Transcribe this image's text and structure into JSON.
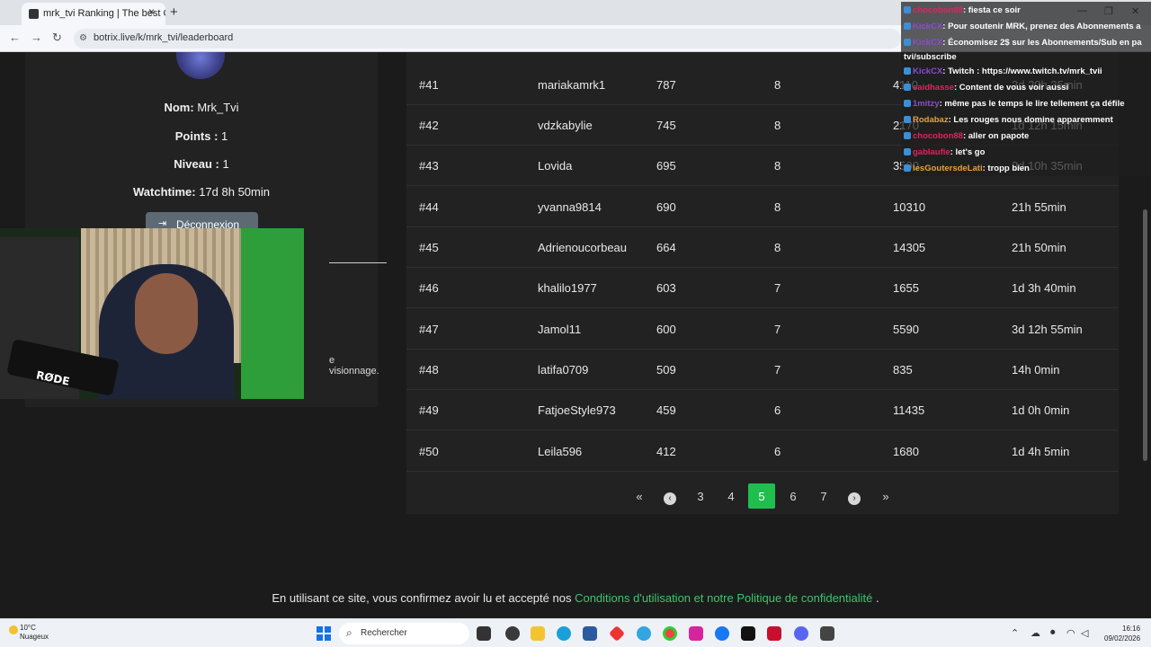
{
  "browser": {
    "tab_title": "mrk_tvi Ranking | The best Cha",
    "url": "botrix.live/k/mrk_tvi/leaderboard",
    "new_tab_label": "+",
    "tab_close_label": "×",
    "back_label": "←",
    "forward_label": "→",
    "reload_label": "↻",
    "minimize_label": "—",
    "restore_label": "❐",
    "window_close_label": "✕"
  },
  "profile": {
    "name_label": "Nom:",
    "name_value": "Mrk_Tvi",
    "points_label": "Points :",
    "points_value": "1",
    "level_label": "Niveau :",
    "level_value": "1",
    "watchtime_label": "Watchtime:",
    "watchtime_value": "17d 8h 50min",
    "logout_label": "Déconnexion",
    "partial_text": "e visionnage."
  },
  "webcam": {
    "mic_label": "RØDE"
  },
  "leaderboard": {
    "rows": [
      {
        "rank": "#41",
        "user": "mariakamrk1",
        "points": "787",
        "level": "8",
        "messages": "4110",
        "watchtime": "2d 20h 35min"
      },
      {
        "rank": "#42",
        "user": "vdzkabylie",
        "points": "745",
        "level": "8",
        "messages": "2170",
        "watchtime": "1d 12h 15min"
      },
      {
        "rank": "#43",
        "user": "Lovida",
        "points": "695",
        "level": "8",
        "messages": "3500",
        "watchtime": "2d 10h 35min"
      },
      {
        "rank": "#44",
        "user": "yvanna9814",
        "points": "690",
        "level": "8",
        "messages": "10310",
        "watchtime": "21h 55min"
      },
      {
        "rank": "#45",
        "user": "Adrienoucorbeau",
        "points": "664",
        "level": "8",
        "messages": "14305",
        "watchtime": "21h 50min"
      },
      {
        "rank": "#46",
        "user": "khalilo1977",
        "points": "603",
        "level": "7",
        "messages": "1655",
        "watchtime": "1d 3h 40min"
      },
      {
        "rank": "#47",
        "user": "Jamol11",
        "points": "600",
        "level": "7",
        "messages": "5590",
        "watchtime": "3d 12h 55min"
      },
      {
        "rank": "#48",
        "user": "latifa0709",
        "points": "509",
        "level": "7",
        "messages": "835",
        "watchtime": "14h 0min"
      },
      {
        "rank": "#49",
        "user": "FatjoeStyle973",
        "points": "459",
        "level": "6",
        "messages": "11435",
        "watchtime": "1d 0h 0min"
      },
      {
        "rank": "#50",
        "user": "Leila596",
        "points": "412",
        "level": "6",
        "messages": "1680",
        "watchtime": "1d 4h 5min"
      }
    ]
  },
  "pagination": {
    "first": "«",
    "prev": "‹",
    "pages": [
      "3",
      "4",
      "5",
      "6",
      "7"
    ],
    "active_page": "5",
    "next": "›",
    "last": "»"
  },
  "footer": {
    "text": "En utilisant ce site, vous confirmez avoir lu et accepté nos",
    "link": "Conditions d'utilisation et notre Politique de confidentialité",
    "end": "."
  },
  "chat": {
    "messages": [
      {
        "user": "chocobon88",
        "text": ": fiesta ce soir",
        "color": "#e0245e"
      },
      {
        "user": "KickCX",
        "text": ": Pour soutenir MRK, prenez des Abonnements a",
        "color": "#8a4bd6"
      },
      {
        "user": "KickCX",
        "text": ": Économisez 2$ sur les Abonnements/Sub en pa",
        "color": "#8a4bd6"
      },
      {
        "user": "",
        "text": "tvi/subscribe",
        "color": "#ffffff"
      },
      {
        "user": "KickCX",
        "text": ": Twitch : https://www.twitch.tv/mrk_tvii",
        "color": "#8a4bd6"
      },
      {
        "user": "saidhasse",
        "text": ": Content de vous voir aussi",
        "color": "#e0245e"
      },
      {
        "user": "1mitzy",
        "text": ": même pas le temps le lire tellement ça défile",
        "color": "#8a4bd6"
      },
      {
        "user": "Rodabaz",
        "text": ": Les rouges nous domine apparemment",
        "color": "#e6a23c"
      },
      {
        "user": "chocobon88",
        "text": ": aller on papote",
        "color": "#e0245e"
      },
      {
        "user": "gablaufie",
        "text": ": let's go",
        "color": "#e0245e"
      },
      {
        "user": "lesGoutersdeLati",
        "text": ": tropp bien",
        "color": "#e6a23c"
      }
    ]
  },
  "taskbar": {
    "weather_temp": "10°C",
    "weather_desc": "Nuageux",
    "search_placeholder": "Rechercher",
    "time": "16:16",
    "date": "09/02/2026"
  },
  "colors": {
    "accent_green": "#1fbe4f",
    "link_green": "#3ec46d",
    "background": "#1b1b1b",
    "panel": "#222222"
  }
}
